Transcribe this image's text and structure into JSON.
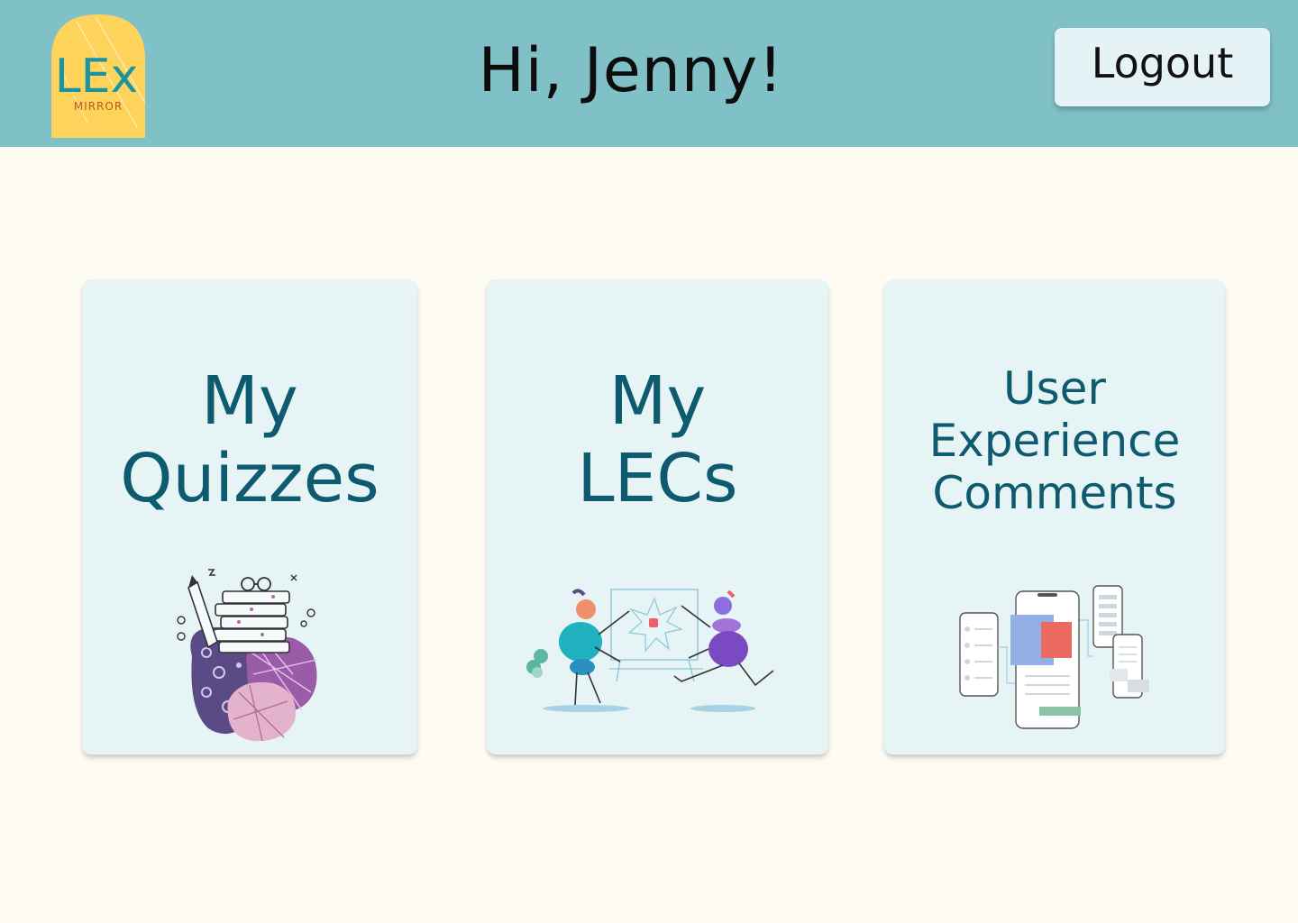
{
  "header": {
    "logo_main": "LEx",
    "logo_sub": "MIRROR",
    "greeting": "Hi, Jenny!",
    "logout_label": "Logout"
  },
  "cards": [
    {
      "title_lines": [
        "My",
        "Quizzes"
      ],
      "illustration": "stacked-books-with-glasses-illustration"
    },
    {
      "title_lines": [
        "My",
        "LECs"
      ],
      "illustration": "two-people-with-board-illustration"
    },
    {
      "title_lines": [
        "User",
        "Experience",
        "Comments"
      ],
      "illustration": "phone-wireframes-illustration"
    }
  ],
  "colors": {
    "header_bg": "#7fc1c7",
    "page_bg": "#fefbf3",
    "card_bg": "#e6f4f6",
    "card_title": "#0e5a6e",
    "logo_yellow": "#fdd35c",
    "logo_teal": "#1a93a3"
  }
}
